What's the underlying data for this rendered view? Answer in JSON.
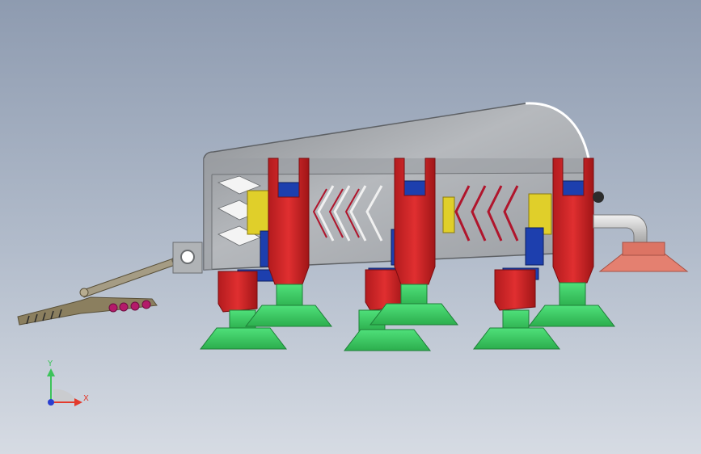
{
  "scene": {
    "kind": "cad-3d-viewport",
    "colors": {
      "housing": "#a9acb1",
      "housing_dark": "#7f8389",
      "red_bracket": "#d4282a",
      "red_dark": "#9d1618",
      "blue_block": "#1d3fae",
      "yellow_part": "#e0cf2a",
      "suction_cup": "#3fd266",
      "suction_cup_dark": "#27a846",
      "pipe": "#c9c9c9",
      "salmon_cup": "#e48070",
      "linkage": "#8f8265",
      "magenta_dot": "#b41a6a"
    },
    "icons": [
      "housing-body",
      "red-bracket",
      "suction-cup",
      "blue-block",
      "linkage-arm",
      "pipe-elbow",
      "coordinate-triad"
    ]
  },
  "triad": {
    "x_label": "X",
    "y_label": "Y",
    "x_color": "#e33a2c",
    "y_color": "#3cc35a",
    "z_color": "#2a3fd0"
  }
}
